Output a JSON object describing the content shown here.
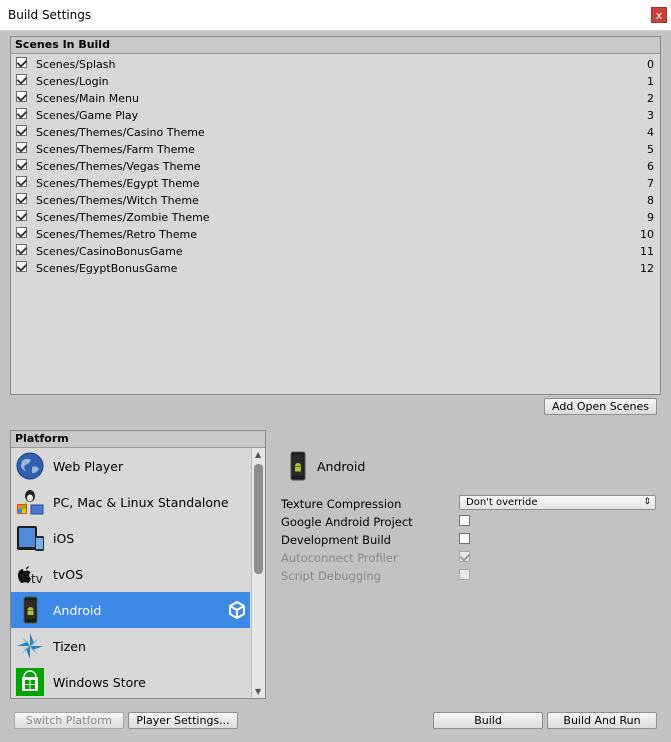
{
  "window": {
    "title": "Build Settings",
    "close_glyph": "x"
  },
  "scenes": {
    "header": "Scenes In Build",
    "items": [
      {
        "name": "Scenes/Splash",
        "index": "0",
        "checked": true
      },
      {
        "name": "Scenes/Login",
        "index": "1",
        "checked": true
      },
      {
        "name": "Scenes/Main Menu",
        "index": "2",
        "checked": true
      },
      {
        "name": "Scenes/Game Play",
        "index": "3",
        "checked": true
      },
      {
        "name": "Scenes/Themes/Casino Theme",
        "index": "4",
        "checked": true
      },
      {
        "name": "Scenes/Themes/Farm Theme",
        "index": "5",
        "checked": true
      },
      {
        "name": "Scenes/Themes/Vegas Theme",
        "index": "6",
        "checked": true
      },
      {
        "name": "Scenes/Themes/Egypt Theme",
        "index": "7",
        "checked": true
      },
      {
        "name": "Scenes/Themes/Witch Theme",
        "index": "8",
        "checked": true
      },
      {
        "name": "Scenes/Themes/Zombie Theme",
        "index": "9",
        "checked": true
      },
      {
        "name": "Scenes/Themes/Retro Theme",
        "index": "10",
        "checked": true
      },
      {
        "name": "Scenes/CasinoBonusGame",
        "index": "11",
        "checked": true
      },
      {
        "name": "Scenes/EgyptBonusGame",
        "index": "12",
        "checked": true
      }
    ],
    "add_open_scenes_label": "Add Open Scenes"
  },
  "platform": {
    "header": "Platform",
    "items": [
      {
        "label": "Web Player",
        "icon": "web-player-globe-icon",
        "selected": false
      },
      {
        "label": "PC, Mac & Linux Standalone",
        "icon": "standalone-pc-icon",
        "selected": false
      },
      {
        "label": "iOS",
        "icon": "ios-device-icon",
        "selected": false
      },
      {
        "label": "tvOS",
        "icon": "apple-tv-icon",
        "icon_text": "tv",
        "selected": false
      },
      {
        "label": "Android",
        "icon": "android-phone-icon",
        "selected": true
      },
      {
        "label": "Tizen",
        "icon": "tizen-icon",
        "selected": false
      },
      {
        "label": "Windows Store",
        "icon": "windows-store-icon",
        "selected": false
      }
    ],
    "selected_platform_name": "Android"
  },
  "settings": {
    "texture_compression_label": "Texture Compression",
    "texture_compression_value": "Don't override",
    "google_android_project_label": "Google Android Project",
    "google_android_project_checked": false,
    "development_build_label": "Development Build",
    "development_build_checked": false,
    "autoconnect_profiler_label": "Autoconnect Profiler",
    "autoconnect_profiler_checked": true,
    "autoconnect_profiler_enabled": false,
    "script_debugging_label": "Script Debugging",
    "script_debugging_checked": false,
    "script_debugging_enabled": false
  },
  "footer": {
    "switch_platform_label": "Switch Platform",
    "player_settings_label": "Player Settings...",
    "build_label": "Build",
    "build_and_run_label": "Build And Run"
  },
  "colors": {
    "selection": "#3c8ae6",
    "panel": "#d8d8d8",
    "background": "#c2c2c2",
    "close_button": "#c7403a"
  }
}
